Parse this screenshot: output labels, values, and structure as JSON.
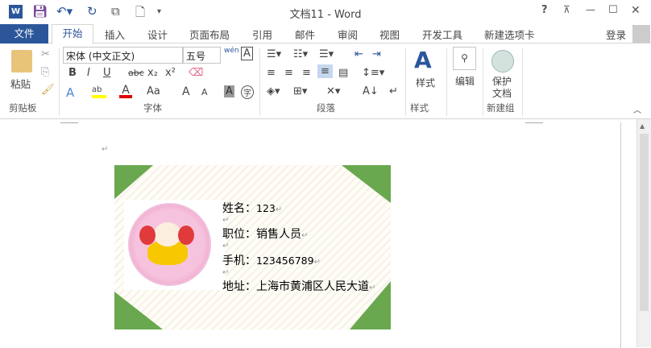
{
  "titlebar": {
    "title": "文档11 - Word",
    "help": "?",
    "restore_ribbon": "⊼",
    "minimize": "—",
    "maximize": "☐",
    "close": "✕"
  },
  "tabs": {
    "file": "文件",
    "items": [
      "开始",
      "插入",
      "设计",
      "页面布局",
      "引用",
      "邮件",
      "审阅",
      "视图",
      "开发工具",
      "新建选项卡"
    ],
    "login": "登录"
  },
  "ribbon": {
    "clipboard": {
      "paste": "粘贴",
      "label": "剪贴板"
    },
    "font": {
      "name": "宋体 (中文正文)",
      "size": "五号",
      "label": "字体",
      "bold": "B",
      "italic": "I",
      "underline": "U",
      "strike": "abc",
      "sub": "x₂",
      "sup": "x²",
      "case": "Aa",
      "grow": "A",
      "shrink": "A",
      "pinyin": "wén",
      "charborder": "A",
      "shading": "A",
      "enclose": "字",
      "highlight_color": "#ffff00",
      "font_color": "#e00000"
    },
    "paragraph": {
      "label": "段落"
    },
    "styles": {
      "button": "样式",
      "label": "样式"
    },
    "editing": {
      "button": "编辑"
    },
    "newgroup": {
      "button_l1": "保护",
      "button_l2": "文档",
      "label": "新建组"
    }
  },
  "document": {
    "paragraph_mark": "↵",
    "card": {
      "lines": [
        {
          "label": "姓名：",
          "value": "123"
        },
        {
          "label": "职位：",
          "value": "销售人员"
        },
        {
          "label": "手机：",
          "value": "123456789"
        },
        {
          "label": "地址：",
          "value": "上海市黄浦区人民大道"
        }
      ],
      "accent": "#6aa84f"
    }
  }
}
